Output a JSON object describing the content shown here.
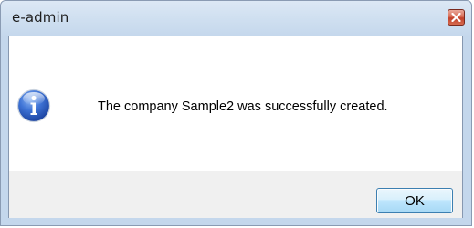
{
  "window": {
    "title": "e-admin"
  },
  "dialog": {
    "message": "The company Sample2 was successfully created.",
    "icon": "information-icon",
    "ok_label": "OK"
  },
  "colors": {
    "close_button": "#c2412a",
    "ok_border": "#3c7fb1",
    "footer_bg": "#f0f0f0"
  }
}
